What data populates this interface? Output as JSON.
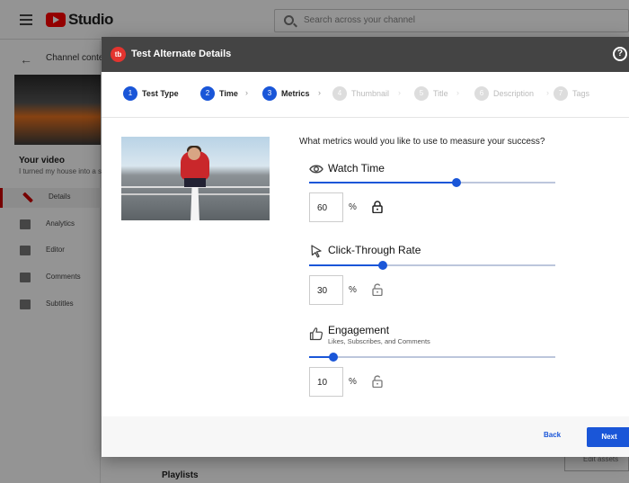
{
  "studio": {
    "logo_text": "Studio",
    "search_placeholder": "Search across your channel",
    "channel_content": "Channel content",
    "your_video_title": "Your video",
    "your_video_subtitle": "I turned my house into a se...",
    "nav": [
      "Details",
      "Analytics",
      "Editor",
      "Comments",
      "Subtitles"
    ],
    "playlists": "Playlists",
    "edit_assets": "Edit assets"
  },
  "dialog": {
    "logo_text": "tb",
    "title": "Test Alternate Details",
    "help_glyph": "?",
    "steps": [
      {
        "num": "1",
        "label": "Test Type",
        "state": "done"
      },
      {
        "num": "2",
        "label": "Time",
        "state": "done"
      },
      {
        "num": "3",
        "label": "Metrics",
        "state": "active"
      },
      {
        "num": "4",
        "label": "Thumbnail",
        "state": "disabled"
      },
      {
        "num": "5",
        "label": "Title",
        "state": "disabled"
      },
      {
        "num": "6",
        "label": "Description",
        "state": "disabled"
      },
      {
        "num": "7",
        "label": "Tags",
        "state": "disabled"
      }
    ],
    "question": "What metrics would you like to use to measure your success?",
    "metrics": [
      {
        "icon": "eye-icon",
        "title": "Watch Time",
        "subtitle": "",
        "value": "60",
        "percent": 60,
        "unit": "%",
        "locked": true
      },
      {
        "icon": "cursor-icon",
        "title": "Click-Through Rate",
        "subtitle": "",
        "value": "30",
        "percent": 30,
        "unit": "%",
        "locked": false
      },
      {
        "icon": "thumbs-up-icon",
        "title": "Engagement",
        "subtitle": "Likes, Subscribes, and Comments",
        "value": "10",
        "percent": 10,
        "unit": "%",
        "locked": false
      }
    ],
    "back_label": "Back",
    "next_label": "Next"
  },
  "colors": {
    "accent": "#1a56d8",
    "header": "#444444",
    "brand_red": "#e3342f"
  }
}
